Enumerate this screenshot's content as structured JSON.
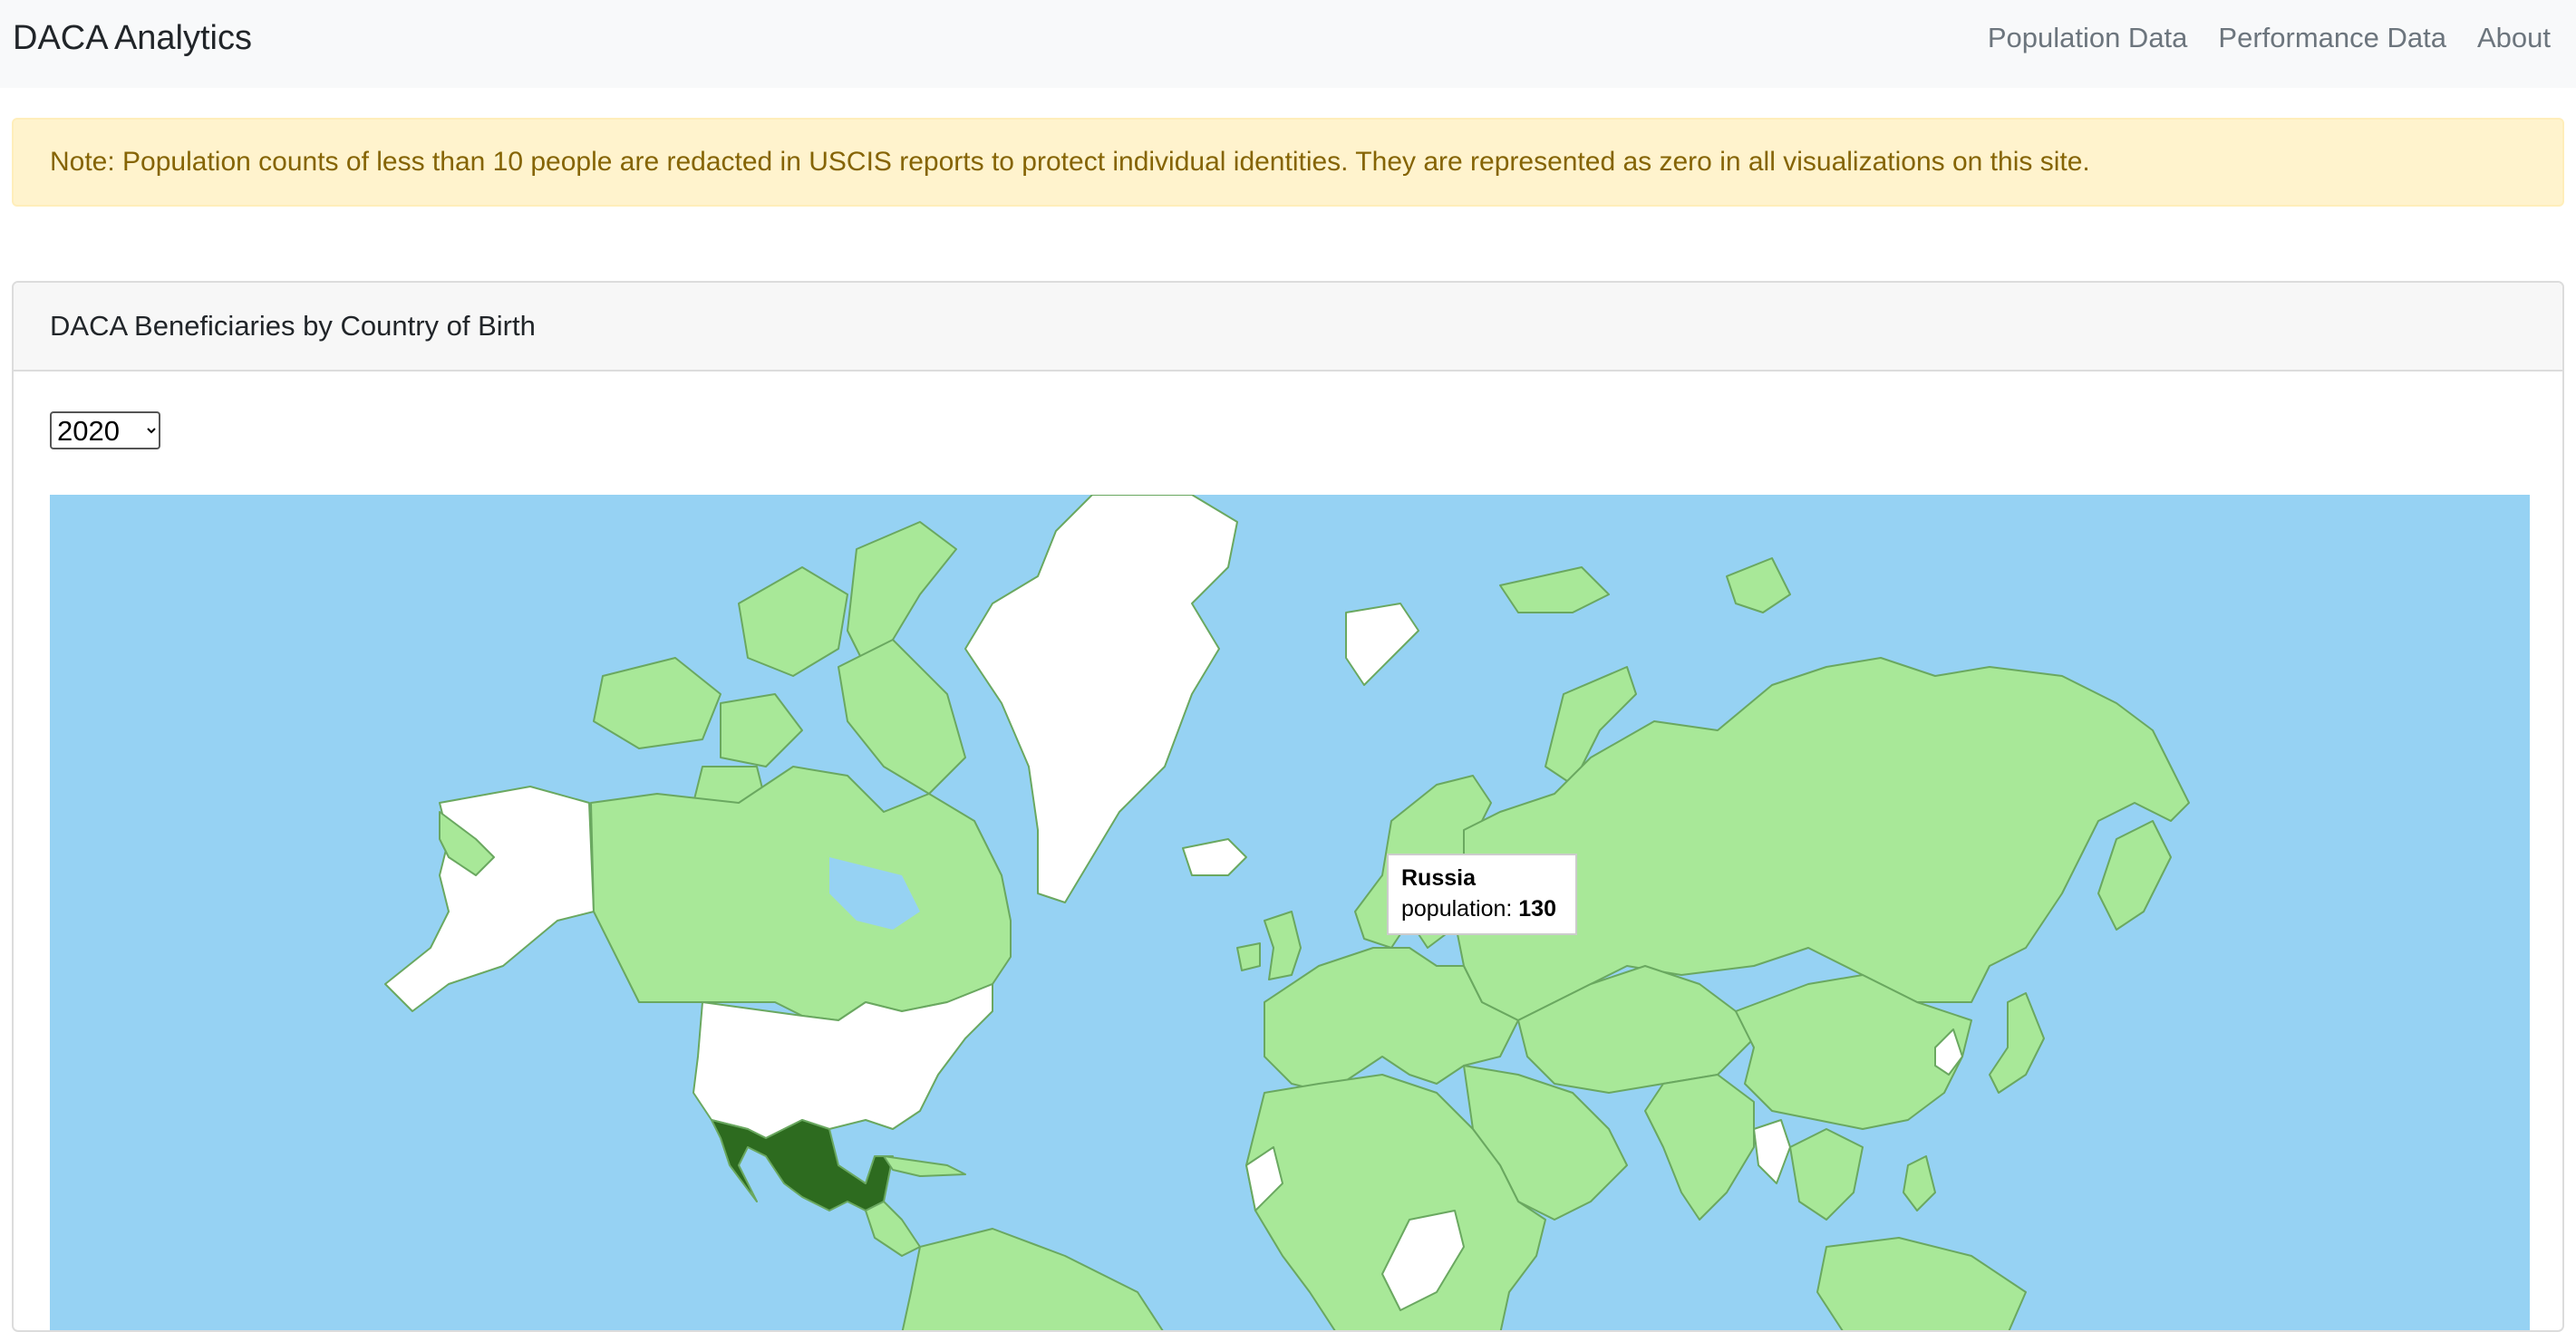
{
  "navbar": {
    "brand": "DACA Analytics",
    "links": [
      {
        "label": "Population Data"
      },
      {
        "label": "Performance Data"
      },
      {
        "label": "About"
      }
    ]
  },
  "alert": {
    "text": "Note: Population counts of less than 10 people are redacted in USCIS reports to protect individual identities. They are represented as zero in all visualizations on this site."
  },
  "card": {
    "title": "DACA Beneficiaries by Country of Birth",
    "year_select": {
      "selected": "2020",
      "options": [
        "2020"
      ]
    }
  },
  "map": {
    "colors": {
      "ocean": "#96d2f3",
      "no_data": "#ffffff",
      "low": "#a8e898",
      "high": "#2d6b1f",
      "border": "#6aa860"
    },
    "tooltip": {
      "country": "Russia",
      "label": "population:",
      "value": "130"
    }
  }
}
